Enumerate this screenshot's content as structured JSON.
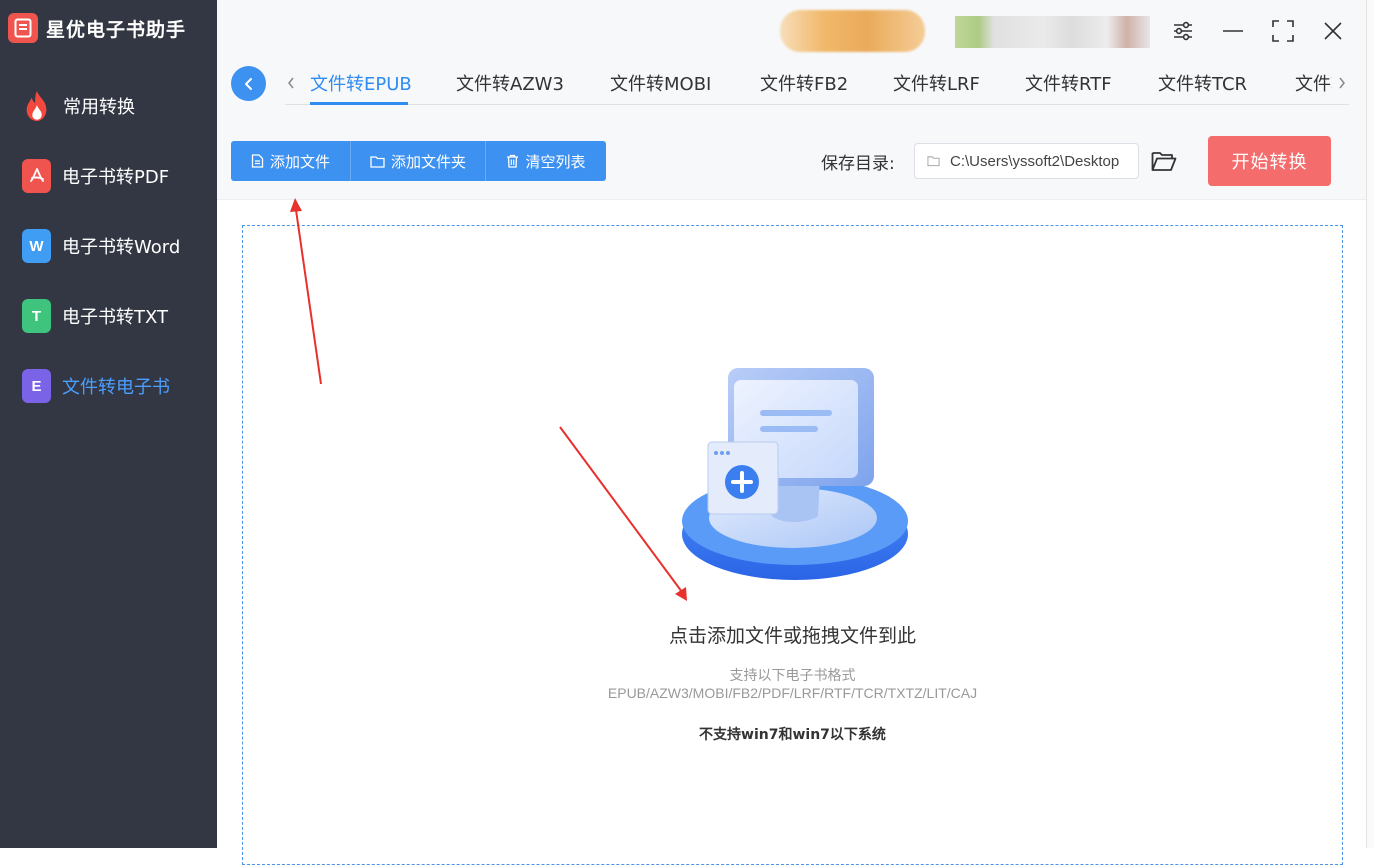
{
  "app": {
    "title": "星优电子书助手"
  },
  "sidebar": {
    "items": [
      {
        "label": "常用转换",
        "icon": "flame-icon"
      },
      {
        "label": "电子书转PDF",
        "icon": "pdf-file-icon"
      },
      {
        "label": "电子书转Word",
        "icon": "word-file-icon",
        "glyph": "W"
      },
      {
        "label": "电子书转TXT",
        "icon": "txt-file-icon",
        "glyph": "T"
      },
      {
        "label": "文件转电子书",
        "icon": "ebook-file-icon",
        "glyph": "E",
        "active": true
      }
    ]
  },
  "tabs": [
    {
      "label": "文件转EPUB",
      "active": true
    },
    {
      "label": "文件转AZW3"
    },
    {
      "label": "文件转MOBI"
    },
    {
      "label": "文件转FB2"
    },
    {
      "label": "文件转LRF"
    },
    {
      "label": "文件转RTF"
    },
    {
      "label": "文件转TCR"
    },
    {
      "label": "文件转"
    }
  ],
  "toolbar": {
    "add_file": "添加文件",
    "add_folder": "添加文件夹",
    "clear_list": "清空列表",
    "save_dir_label": "保存目录:",
    "save_dir_value": "C:\\Users\\yssoft2\\Desktop",
    "start": "开始转换"
  },
  "drop": {
    "title": "点击添加文件或拖拽文件到此",
    "subtitle": "支持以下电子书格式",
    "formats": "EPUB/AZW3/MOBI/FB2/PDF/LRF/RTF/TCR/TXTZ/LIT/CAJ",
    "note": "不支持win7和win7以下系统"
  },
  "colors": {
    "sidebar_bg": "#323743",
    "accent": "#2f8cf0",
    "button_blue": "#3d91f1",
    "start_red": "#f46c6c",
    "annotation_red": "#e8302c"
  }
}
